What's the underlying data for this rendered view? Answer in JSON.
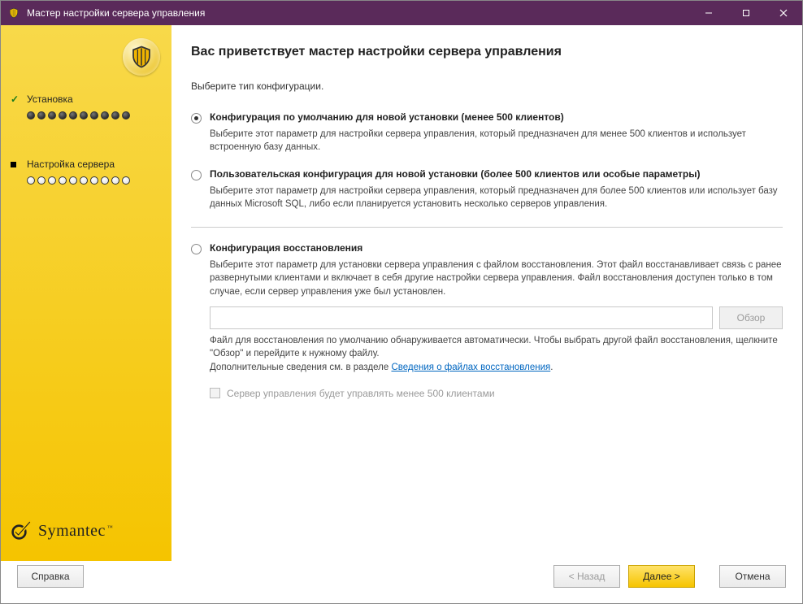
{
  "titlebar": {
    "title": "Мастер настройки сервера управления"
  },
  "sidebar": {
    "step1": {
      "label": "Установка",
      "dots_total": 10,
      "dots_filled": 10,
      "status": "done"
    },
    "step2": {
      "label": "Настройка сервера",
      "dots_total": 10,
      "dots_filled": 0,
      "status": "current"
    },
    "brand": "Symantec"
  },
  "content": {
    "heading": "Вас приветствует мастер настройки сервера управления",
    "subtext": "Выберите тип конфигурации.",
    "options": [
      {
        "selected": true,
        "title": "Конфигурация по умолчанию для новой установки (менее 500 клиентов)",
        "desc": "Выберите этот параметр для настройки сервера управления, который предназначен для менее 500 клиентов и использует встроенную базу данных."
      },
      {
        "selected": false,
        "title": "Пользовательская конфигурация для новой установки (более 500 клиентов или особые параметры)",
        "desc": "Выберите этот параметр для настройки сервера управления, который предназначен для более 500 клиентов или использует базу данных Microsoft SQL, либо если планируется установить несколько серверов управления."
      },
      {
        "selected": false,
        "title": "Конфигурация восстановления",
        "desc": "Выберите этот параметр для установки сервера управления с файлом восстановления. Этот файл восстанавливает связь с ранее развернутыми клиентами и включает в себя другие настройки сервера управления. Файл восстановления доступен только в том случае, если сервер управления уже был установлен."
      }
    ],
    "browse_label": "Обзор",
    "note_line1": "Файл для восстановления по умолчанию обнаруживается автоматически. Чтобы выбрать другой файл восстановления, щелкните \"Обзор\" и перейдите к нужному файлу.",
    "note_line2_prefix": "Дополнительные сведения см. в разделе ",
    "note_link": "Сведения о файлах восстановления",
    "note_link_suffix": ".",
    "checkbox_label": "Сервер управления будет управлять менее 500 клиентами"
  },
  "footer": {
    "help": "Справка",
    "back": "< Назад",
    "next_prefix": "Д",
    "next_rest": "алее >",
    "cancel": "Отмена"
  }
}
